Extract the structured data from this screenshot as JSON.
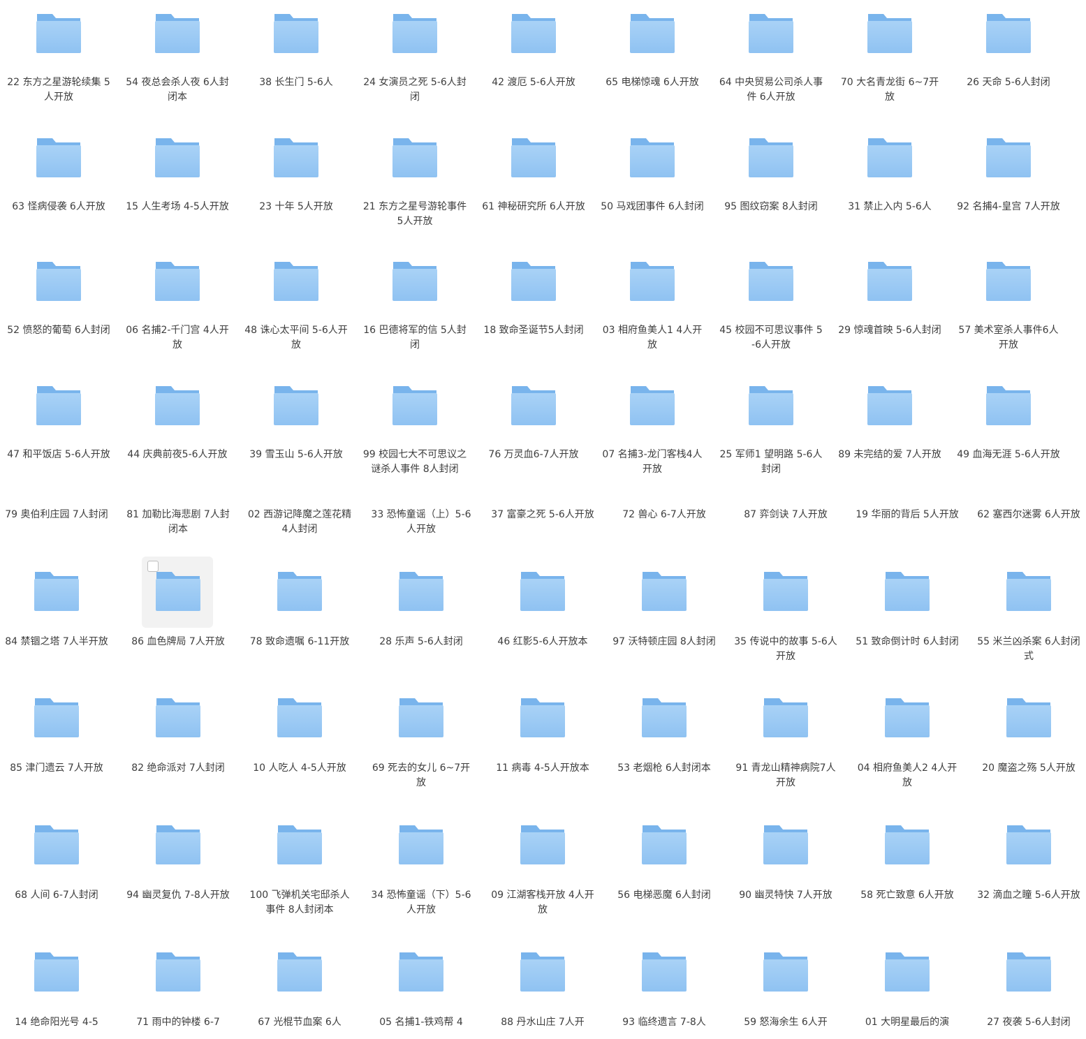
{
  "folder_colors": {
    "tab": "#79b4ec",
    "body_top": "#a9d2f6",
    "body_bottom": "#8fc2f2"
  },
  "folders": [
    "22 东方之星游轮续集 5人开放",
    "54 夜总会杀人夜 6人封闭本",
    "38 长生门 5-6人",
    "24 女演员之死 5-6人封闭",
    "42 渡厄 5-6人开放",
    "65 电梯惊魂 6人开放",
    "64 中央贸易公司杀人事件 6人开放",
    "70 大名青龙街 6~7开放",
    "26 天命 5-6人封闭",
    "63 怪病侵袭 6人开放",
    "15 人生考场 4-5人开放",
    "23 十年 5人开放",
    "21 东方之星号游轮事件 5人开放",
    "61 神秘研究所 6人开放",
    "50 马戏团事件 6人封闭",
    "95 图纹窃案 8人封闭",
    "31 禁止入内 5-6人",
    "92 名捕4-皇宫 7人开放",
    "52 愤怒的葡萄 6人封闭",
    "06 名捕2-千门宫 4人开放",
    "48 诛心太平间 5-6人开放",
    "16 巴德将军的信 5人封闭",
    "18 致命圣诞节5人封闭",
    "03 相府鱼美人1 4人开放",
    "45 校园不可思议事件 5-6人开放",
    "29 惊魂首映 5-6人封闭",
    "57 美术室杀人事件6人开放",
    "47 和平饭店 5-6人开放",
    "44 庆典前夜5-6人开放",
    "39 雪玉山 5-6人开放",
    "99 校园七大不可思议之谜杀人事件 8人封闭",
    "76 万灵血6-7人开放",
    "07 名捕3-龙门客栈4人开放",
    "25 军师1 望明路 5-6人封闭",
    "89 未完结的爱 7人开放",
    "49 血海无涯 5-6人开放",
    "79 奥伯利庄园 7人封闭",
    "81 加勒比海悲剧 7人封闭本",
    "02 西游记降魔之莲花精 4人封闭",
    "33 恐怖童谣（上）5-6人开放",
    "37 富豪之死 5-6人开放",
    "72 兽心 6-7人开放",
    "87 弈剑诀 7人开放",
    "19 华丽的背后 5人开放",
    "62 塞西尔迷雾 6人开放",
    "84 禁锢之塔 7人半开放",
    "86 血色牌局 7人开放",
    "78 致命遗嘱 6-11开放",
    "28 乐声 5-6人封闭",
    "46 红影5-6人开放本",
    "97 沃特顿庄园 8人封闭",
    "35 传说中的故事 5-6人开放",
    "51 致命倒计时 6人封闭",
    "55 米兰凶杀案 6人封闭式",
    "85 津门遗云 7人开放",
    "82 绝命派对 7人封闭",
    "10 人吃人 4-5人开放",
    "69 死去的女儿 6~7开放",
    "11 病毒 4-5人开放本",
    "53 老烟枪 6人封闭本",
    "91 青龙山精神病院7人开放",
    "04 相府鱼美人2 4人开放",
    "20 魔盗之殇 5人开放",
    "68 人间 6-7人封闭",
    "94 幽灵复仇 7-8人开放",
    "100 飞弹机关宅邸杀人事件 8人封闭本",
    "34 恐怖童谣（下）5-6人开放",
    "09 江湖客栈开放 4人开放",
    "56 电梯恶魔 6人封闭",
    "90 幽灵特快 7人开放",
    "58 死亡致意 6人开放",
    "32 滴血之瞳 5-6人开放",
    "14 绝命阳光号 4-5",
    "71 雨中的钟楼 6-7",
    "67 光棍节血案 6人",
    "05 名捕1-铁鸡帮 4",
    "88 丹水山庄 7人开",
    "93 临终遗言 7-8人",
    "59 怒海余生 6人开",
    "01 大明星最后的演",
    "27 夜袭 5-6人封闭"
  ],
  "selected_index": 46
}
